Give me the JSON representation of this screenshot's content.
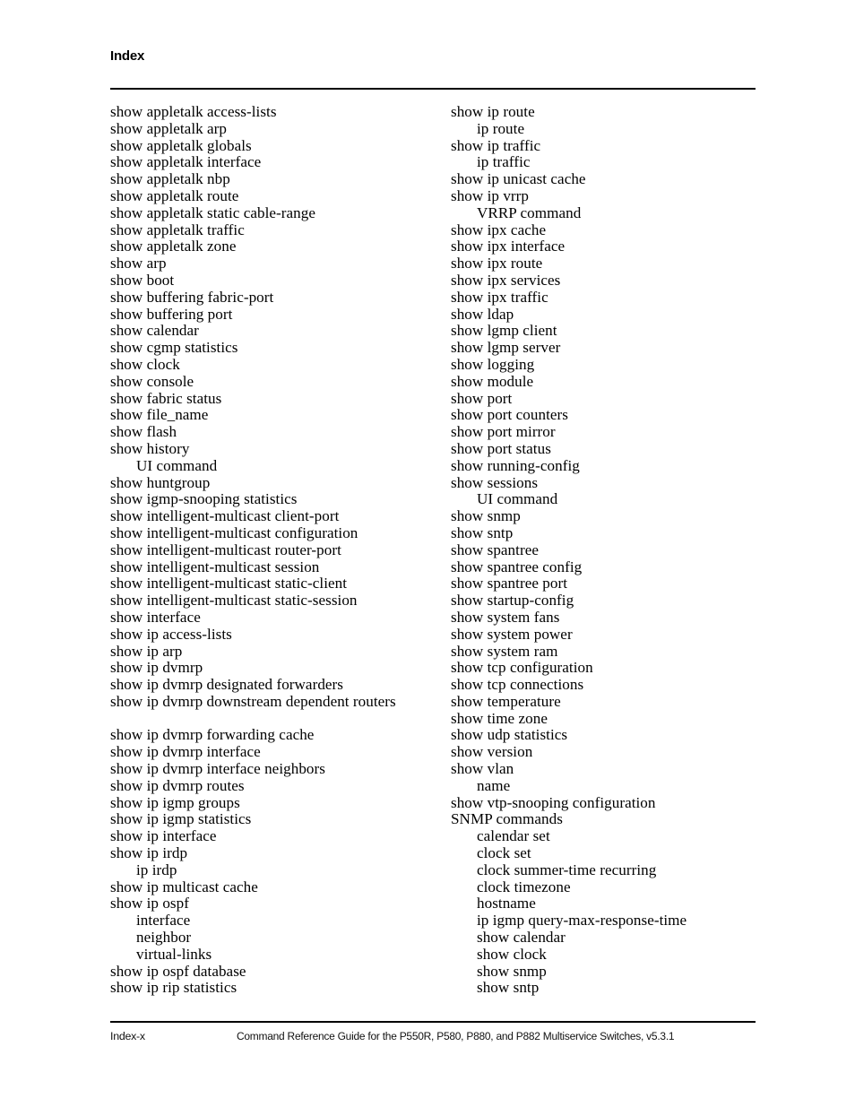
{
  "header": {
    "title": "Index"
  },
  "index": {
    "left_column": [
      {
        "text": "show appletalk access-lists",
        "level": 1
      },
      {
        "text": "show appletalk arp",
        "level": 1
      },
      {
        "text": "show appletalk globals",
        "level": 1
      },
      {
        "text": "show appletalk interface",
        "level": 1
      },
      {
        "text": "show appletalk nbp",
        "level": 1
      },
      {
        "text": "show appletalk route",
        "level": 1
      },
      {
        "text": "show appletalk static cable-range",
        "level": 1
      },
      {
        "text": "show appletalk traffic",
        "level": 1
      },
      {
        "text": "show appletalk zone",
        "level": 1
      },
      {
        "text": "show arp",
        "level": 1
      },
      {
        "text": "show boot",
        "level": 1
      },
      {
        "text": "show buffering fabric-port",
        "level": 1
      },
      {
        "text": "show buffering port",
        "level": 1
      },
      {
        "text": "show calendar",
        "level": 1
      },
      {
        "text": "show cgmp statistics",
        "level": 1
      },
      {
        "text": "show clock",
        "level": 1
      },
      {
        "text": "show console",
        "level": 1
      },
      {
        "text": "show fabric status",
        "level": 1
      },
      {
        "text": "show file_name",
        "level": 1
      },
      {
        "text": "show flash",
        "level": 1
      },
      {
        "text": "show history",
        "level": 1
      },
      {
        "text": "UI command",
        "level": 2
      },
      {
        "text": "show huntgroup",
        "level": 1
      },
      {
        "text": "show igmp-snooping statistics",
        "level": 1
      },
      {
        "text": "show intelligent-multicast client-port",
        "level": 1
      },
      {
        "text": "show intelligent-multicast configuration",
        "level": 1
      },
      {
        "text": "show intelligent-multicast router-port",
        "level": 1
      },
      {
        "text": "show intelligent-multicast session",
        "level": 1
      },
      {
        "text": "show intelligent-multicast static-client",
        "level": 1
      },
      {
        "text": "show intelligent-multicast static-session",
        "level": 1
      },
      {
        "text": "show interface",
        "level": 1
      },
      {
        "text": "show ip access-lists",
        "level": 1
      },
      {
        "text": "show ip arp",
        "level": 1
      },
      {
        "text": "show ip dvmrp",
        "level": 1
      },
      {
        "text": "show ip dvmrp designated forwarders",
        "level": 1
      },
      {
        "text": "show ip dvmrp downstream dependent routers",
        "level": 1
      },
      {
        "text": "",
        "level": 0
      },
      {
        "text": "show ip dvmrp forwarding cache",
        "level": 1
      },
      {
        "text": "show ip dvmrp interface",
        "level": 1
      },
      {
        "text": "show ip dvmrp interface neighbors",
        "level": 1
      },
      {
        "text": "show ip dvmrp routes",
        "level": 1
      },
      {
        "text": "show ip igmp groups",
        "level": 1
      },
      {
        "text": "show ip igmp statistics",
        "level": 1
      },
      {
        "text": "show ip interface",
        "level": 1
      },
      {
        "text": "show ip irdp",
        "level": 1
      },
      {
        "text": "ip irdp",
        "level": 2
      },
      {
        "text": "show ip multicast cache",
        "level": 1
      },
      {
        "text": "show ip ospf",
        "level": 1
      },
      {
        "text": "interface",
        "level": 2
      },
      {
        "text": "neighbor",
        "level": 2
      },
      {
        "text": "virtual-links",
        "level": 2
      },
      {
        "text": "show ip ospf database",
        "level": 1
      },
      {
        "text": "show ip rip statistics",
        "level": 1
      }
    ],
    "right_column": [
      {
        "text": "show ip route",
        "level": 1
      },
      {
        "text": "ip route",
        "level": 2
      },
      {
        "text": "show ip traffic",
        "level": 1
      },
      {
        "text": "ip traffic",
        "level": 2
      },
      {
        "text": "show ip unicast cache",
        "level": 1
      },
      {
        "text": "show ip vrrp",
        "level": 1
      },
      {
        "text": "VRRP command",
        "level": 2
      },
      {
        "text": "show ipx cache",
        "level": 1
      },
      {
        "text": "show ipx interface",
        "level": 1
      },
      {
        "text": "show ipx route",
        "level": 1
      },
      {
        "text": "show ipx services",
        "level": 1
      },
      {
        "text": "show ipx traffic",
        "level": 1
      },
      {
        "text": "show ldap",
        "level": 1
      },
      {
        "text": "show lgmp client",
        "level": 1
      },
      {
        "text": "show lgmp server",
        "level": 1
      },
      {
        "text": "show logging",
        "level": 1
      },
      {
        "text": "show module",
        "level": 1
      },
      {
        "text": "show port",
        "level": 1
      },
      {
        "text": "show port counters",
        "level": 1
      },
      {
        "text": "show port mirror",
        "level": 1
      },
      {
        "text": "show port status",
        "level": 1
      },
      {
        "text": "show running-config",
        "level": 1
      },
      {
        "text": "show sessions",
        "level": 1
      },
      {
        "text": "UI command",
        "level": 2
      },
      {
        "text": "show snmp",
        "level": 1
      },
      {
        "text": "show sntp",
        "level": 1
      },
      {
        "text": "show spantree",
        "level": 1
      },
      {
        "text": "show spantree config",
        "level": 1
      },
      {
        "text": "show spantree port",
        "level": 1
      },
      {
        "text": "show startup-config",
        "level": 1
      },
      {
        "text": "show system fans",
        "level": 1
      },
      {
        "text": "show system power",
        "level": 1
      },
      {
        "text": "show system ram",
        "level": 1
      },
      {
        "text": "show tcp configuration",
        "level": 1
      },
      {
        "text": "show tcp connections",
        "level": 1
      },
      {
        "text": "show temperature",
        "level": 1
      },
      {
        "text": "show time zone",
        "level": 1
      },
      {
        "text": "show udp statistics",
        "level": 1
      },
      {
        "text": "show version",
        "level": 1
      },
      {
        "text": "show vlan",
        "level": 1
      },
      {
        "text": "name",
        "level": 2
      },
      {
        "text": "show vtp-snooping configuration",
        "level": 1
      },
      {
        "text": "SNMP commands",
        "level": 1
      },
      {
        "text": "calendar set",
        "level": 2
      },
      {
        "text": "clock set",
        "level": 2
      },
      {
        "text": "clock summer-time recurring",
        "level": 2
      },
      {
        "text": "clock timezone",
        "level": 2
      },
      {
        "text": "hostname",
        "level": 2
      },
      {
        "text": "ip igmp query-max-response-time",
        "level": 2
      },
      {
        "text": "show calendar",
        "level": 2
      },
      {
        "text": "show clock",
        "level": 2
      },
      {
        "text": "show snmp",
        "level": 2
      },
      {
        "text": "show sntp",
        "level": 2
      }
    ]
  },
  "footer": {
    "page_label": "Index-x",
    "document_title": "Command Reference Guide for the P550R, P580, P880, and P882 Multiservice Switches, v5.3.1"
  }
}
